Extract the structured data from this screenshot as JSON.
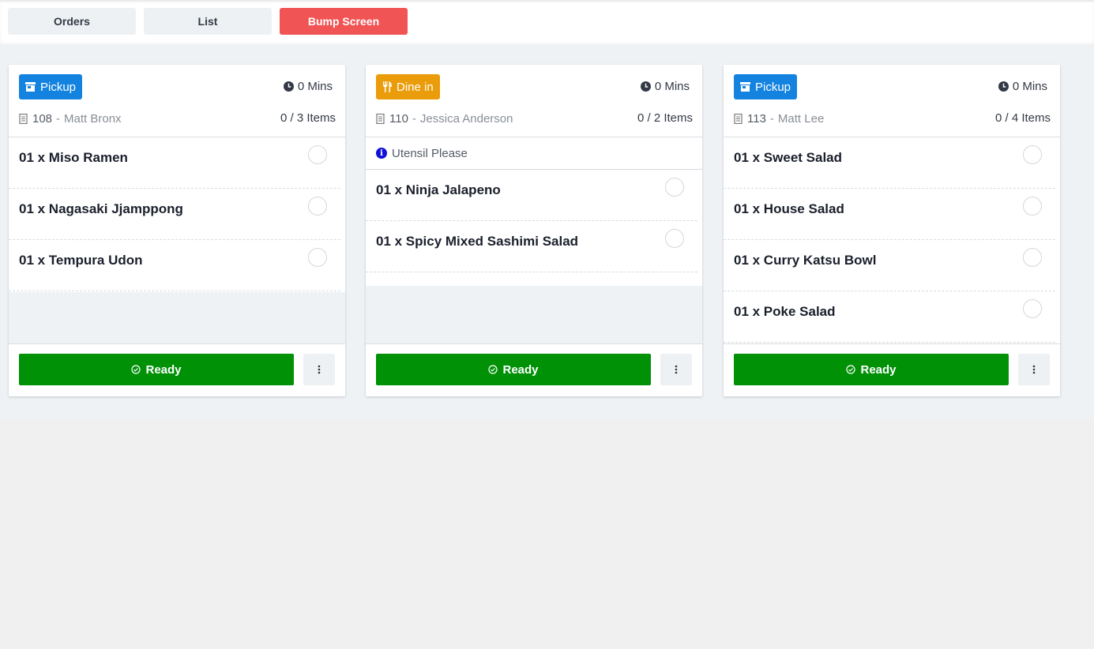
{
  "toolbar": {
    "tabs": [
      {
        "label": "Orders"
      },
      {
        "label": "List"
      },
      {
        "label": "Bump Screen"
      }
    ]
  },
  "colors": {
    "pickup": "#1483e0",
    "dine_in": "#eb9c0a",
    "ready": "#009107",
    "bump_active": "#f05454",
    "note_icon": "#1010d8"
  },
  "cards": [
    {
      "type_label": "Pickup",
      "type_icon": "store-icon",
      "timer": "0 Mins",
      "order_number": "108",
      "separator": "-",
      "customer": "Matt Bronx",
      "items_count": "0 / 3 Items",
      "items": [
        {
          "label": "01 x Miso Ramen"
        },
        {
          "label": "01 x Nagasaki Jjamppong"
        },
        {
          "label": "01 x Tempura Udon"
        }
      ],
      "ready_label": "Ready"
    },
    {
      "type_label": "Dine in",
      "type_icon": "utensils-icon",
      "timer": "0 Mins",
      "order_number": "110",
      "separator": "-",
      "customer": "Jessica Anderson",
      "items_count": "0 / 2 Items",
      "note": "Utensil Please",
      "items": [
        {
          "label": "01 x Ninja Jalapeno"
        },
        {
          "label": "01 x Spicy Mixed Sashimi Salad"
        }
      ],
      "ready_label": "Ready"
    },
    {
      "type_label": "Pickup",
      "type_icon": "store-icon",
      "timer": "0 Mins",
      "order_number": "113",
      "separator": "-",
      "customer": "Matt Lee",
      "items_count": "0 / 4 Items",
      "items": [
        {
          "label": "01 x Sweet Salad"
        },
        {
          "label": "01 x House Salad"
        },
        {
          "label": "01 x Curry Katsu Bowl"
        },
        {
          "label": "01 x Poke Salad"
        }
      ],
      "ready_label": "Ready"
    }
  ]
}
